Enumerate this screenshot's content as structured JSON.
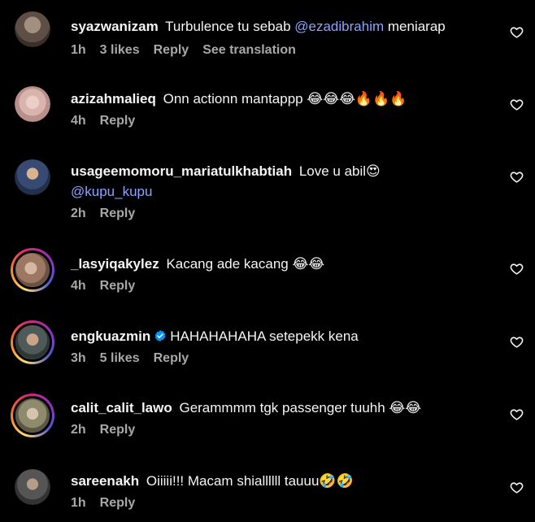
{
  "comments": [
    {
      "username": "syazwanizam",
      "text": "Turbulence tu sebab",
      "mention": "@ezadibrahim",
      "text_after": "meniarap",
      "time": "1h",
      "likes": "3 likes",
      "reply": "Reply",
      "translate": "See translation",
      "avatar_icon": "profile-photo",
      "avatar_color": "#6a5d55"
    },
    {
      "username": "azizahmalieq",
      "text": "Onn actionn mantappp 😂😂😂🔥🔥🔥",
      "time": "4h",
      "reply": "Reply",
      "avatar_icon": "profile-photo",
      "avatar_color": "#c9a6a2"
    },
    {
      "username": "usageemomoru_mariatulkhabtiah",
      "text": "Love u abil😍",
      "mention": "@kupu_kupu",
      "time": "2h",
      "reply": "Reply",
      "avatar_icon": "profile-photo",
      "avatar_color": "#4a5a78"
    },
    {
      "username": "_lasyiqakylez",
      "text": "Kacang ade kacang 😂😂",
      "time": "4h",
      "reply": "Reply",
      "avatar_icon": "profile-photo",
      "avatar_color": "#b08b74"
    },
    {
      "username": "engkuazmin",
      "text": "HAHAHAHAHA setepekk kena",
      "time": "3h",
      "likes": "5 likes",
      "reply": "Reply",
      "avatar_icon": "profile-photo",
      "avatar_color": "#5f6b6a",
      "verified": true
    },
    {
      "username": "calit_calit_lawo",
      "text": "Gerammmm tgk passenger tuuhh 😂😂",
      "time": "2h",
      "reply": "Reply",
      "avatar_icon": "profile-photo",
      "avatar_color": "#8d8a6e"
    },
    {
      "username": "sareenakh",
      "text": "Oiiiii!!! Macam shiallllll tauuu🤣🤣",
      "time": "1h",
      "reply": "Reply",
      "avatar_icon": "profile-photo",
      "avatar_color": "#5a5a5a"
    }
  ],
  "colors": {
    "background": "#000000",
    "text": "#f5f5f5",
    "meta": "#a8a8a8",
    "mention": "#8ea2ff",
    "verified": "#0095f6"
  },
  "icons": {
    "like": "heart-icon",
    "verified": "verified-badge-icon"
  }
}
